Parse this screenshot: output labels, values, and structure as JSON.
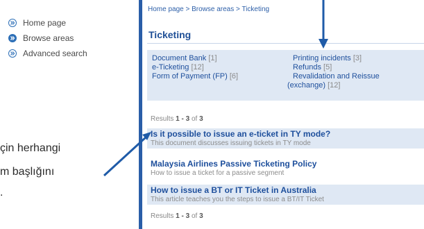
{
  "nav": {
    "items": [
      {
        "label": "Home page",
        "icon": "chevron-right-outline-icon"
      },
      {
        "label": "Browse areas",
        "icon": "chevron-right-filled-icon"
      },
      {
        "label": "Advanced search",
        "icon": "chevron-right-outline-icon"
      }
    ]
  },
  "annotation": {
    "line1": "çin herhangi",
    "line2": "m başlığını",
    "line3": "."
  },
  "breadcrumb": "Home page > Browse areas > Ticketing",
  "page_title": "Ticketing",
  "categories": {
    "left": [
      {
        "label": "Document Bank",
        "count": "[1]"
      },
      {
        "label": "e-Ticketing",
        "count": "[12]"
      },
      {
        "label": "Form of Payment (FP)",
        "count": "[6]"
      }
    ],
    "right": [
      {
        "label": "Printing incidents",
        "count": "[3]"
      },
      {
        "label": "Refunds",
        "count": "[5]"
      },
      {
        "label": "Revalidation and Reissue",
        "label2": "(exchange)",
        "count": "[12]"
      }
    ]
  },
  "results_summary": {
    "prefix": "Results",
    "range": "1 - 3",
    "of": "of",
    "total": "3"
  },
  "results": [
    {
      "title": "Is it possible to issue an e-ticket in TY mode?",
      "desc": "This document discusses issuing tickets in TY mode"
    },
    {
      "title": "Malaysia Airlines Passive Ticketing Policy",
      "desc": "How to issue a ticket for a passive segment"
    },
    {
      "title": "How to issue a BT or IT Ticket in Australia",
      "desc": "This article teaches you the steps to issue a BT/IT Ticket"
    }
  ],
  "colors": {
    "accent": "#2a5ea8",
    "link": "#1e4f9c",
    "panel": "#dfe8f4"
  }
}
